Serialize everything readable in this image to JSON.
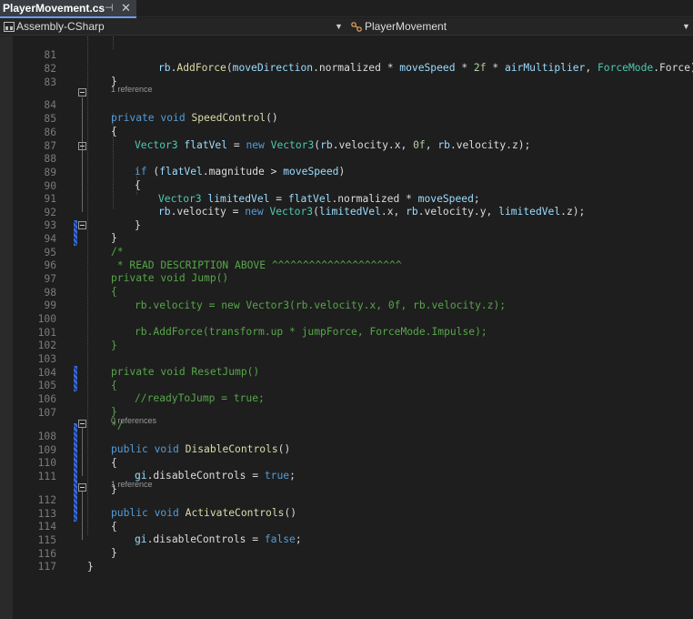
{
  "tab": {
    "title": "PlayerMovement.cs",
    "pin": "⊣",
    "close": "✕"
  },
  "nav": {
    "project": "Assembly-CSharp",
    "member": "PlayerMovement"
  },
  "codelens": {
    "one_ref": "1 reference",
    "zero_ref": "0 references"
  },
  "lines": {
    "81": "rb.AddForce(moveDirection.normalized * moveSpeed * 2f * airMultiplier, ForceMode.Force);",
    "82": "}",
    "84": "private void SpeedControl()",
    "85": "{",
    "86": "Vector3 flatVel = new Vector3(rb.velocity.x, 0f, rb.velocity.z);",
    "88": "if (flatVel.magnitude > moveSpeed)",
    "89": "{",
    "90": "Vector3 limitedVel = flatVel.normalized * moveSpeed;",
    "91": "rb.velocity = new Vector3(limitedVel.x, rb.velocity.y, limitedVel.z);",
    "92": "}",
    "93": "}",
    "94": "/*",
    "95": " * READ DESCRIPTION ABOVE ^^^^^^^^^^^^^^^^^^^^^",
    "96": "private void Jump()",
    "97": "{",
    "98": "rb.velocity = new Vector3(rb.velocity.x, 0f, rb.velocity.z);",
    "100": "rb.AddForce(transform.up * jumpForce, ForceMode.Impulse);",
    "101": "}",
    "103": "private void ResetJump()",
    "104": "{",
    "105": "//readyToJump = true;",
    "106": "}",
    "107": "*/",
    "108": "public void DisableControls()",
    "109": "{",
    "110": "gi.disableControls = true;",
    "111": "}",
    "112": "public void ActivateControls()",
    "113": "{",
    "114": "gi.disableControls = false;",
    "115": "}",
    "116": "}"
  },
  "line_numbers": [
    "81",
    "82",
    "83",
    "84",
    "85",
    "86",
    "87",
    "88",
    "89",
    "90",
    "91",
    "92",
    "93",
    "94",
    "95",
    "96",
    "97",
    "98",
    "99",
    "100",
    "101",
    "102",
    "103",
    "104",
    "105",
    "106",
    "107",
    "108",
    "109",
    "110",
    "111",
    "112",
    "113",
    "114",
    "115",
    "116",
    "117"
  ],
  "colors": {
    "keyword": "#569cd6",
    "type": "#4ec9b0",
    "method": "#dcdcaa",
    "local": "#9cdcfe",
    "comment": "#57a64a",
    "number": "#b5cea8"
  }
}
